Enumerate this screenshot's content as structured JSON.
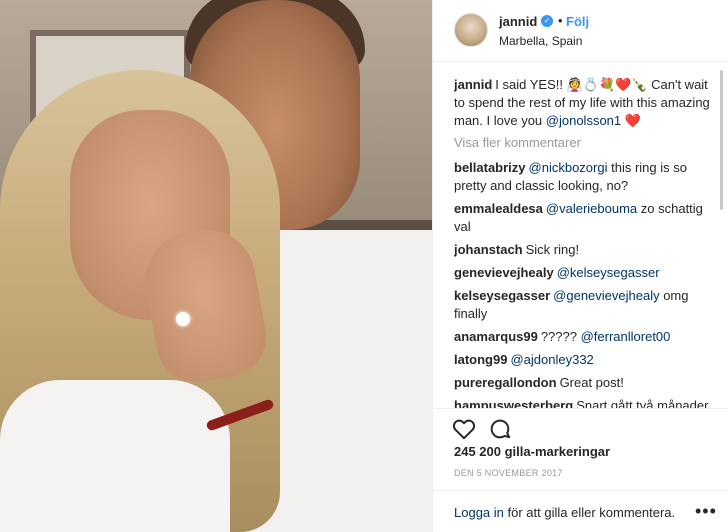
{
  "post": {
    "username": "jannid",
    "follow_label": "Följ",
    "dot": "•",
    "location": "Marbella, Spain",
    "caption": {
      "user": "jannid",
      "text_before": "I said YES!! 👰💍💐❤️🍾 Can't wait to spend the rest of my life with this amazing man. I love you ",
      "mention": "@jonolsson1",
      "text_after": " ❤️"
    },
    "more_comments_label": "Visa fler kommentarer",
    "comments": [
      {
        "user": "bellatabrizy",
        "mention": "@nickbozorgi",
        "text": " this ring is so pretty and classic looking, no?"
      },
      {
        "user": "emmalealdesa",
        "mention": "@valeriebouma",
        "text": " zo schattig val"
      },
      {
        "user": "johanstach",
        "mention": "",
        "text": "Sick ring!"
      },
      {
        "user": "genevievejhealy",
        "mention": "@kelseysegasser",
        "text": ""
      },
      {
        "user": "kelseysegasser",
        "mention": "@genevievejhealy",
        "text": " omg finally"
      },
      {
        "user": "anamarqus99",
        "mention": "",
        "text": "????? ",
        "mention2": "@ferranlloret00"
      },
      {
        "user": "latong99",
        "mention": "@ajdonley332",
        "text": ""
      },
      {
        "user": "pureregallondon",
        "mention": "",
        "text": "Great post!"
      },
      {
        "user": "hampuswesterberg",
        "mention": "",
        "text": "Snart gått två månader, dags att slidea in i DM nu när"
      }
    ],
    "likes": "245 200 gilla-markeringar",
    "date": "DEN 5 NOVEMBER 2017",
    "login_link": "Logga in",
    "login_text": " för att gilla eller kommentera.",
    "more_dots": "•••",
    "icons": {
      "like": "heart-icon",
      "comment": "comment-icon",
      "verified": "verified-badge-icon",
      "more": "more-options-icon"
    }
  }
}
